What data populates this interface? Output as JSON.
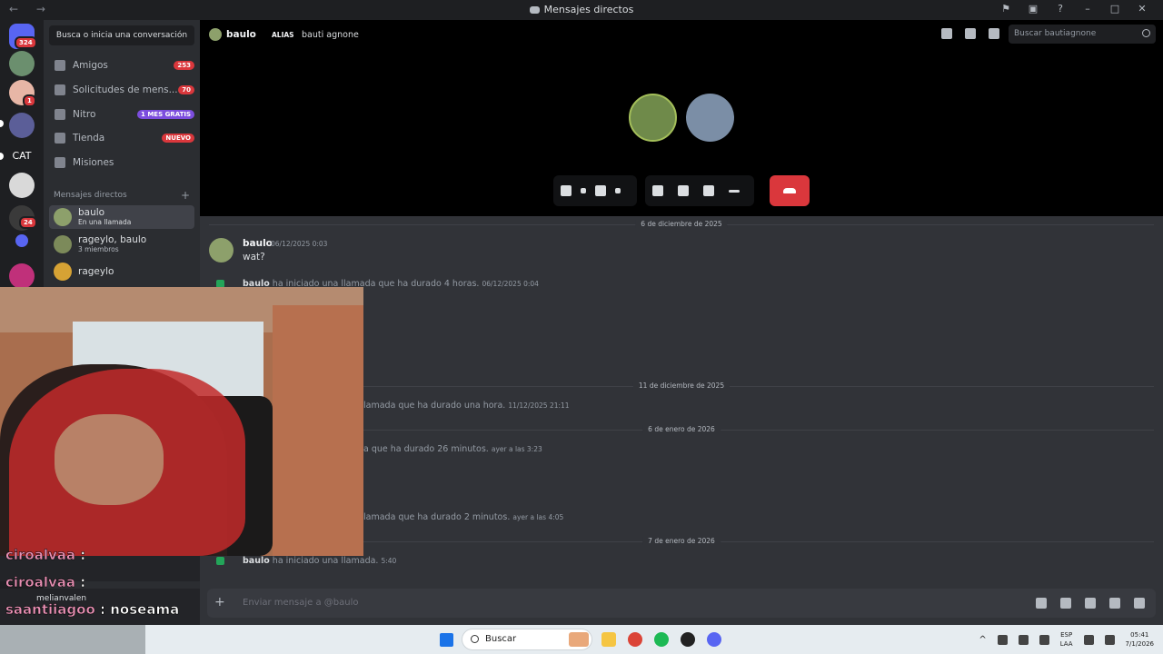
{
  "window": {
    "title": "Mensajes directos",
    "nav": "← →"
  },
  "servers": {
    "home_badge": "324",
    "badge2": "1",
    "label_cat": "CAT",
    "badge_24": "24"
  },
  "sidebar": {
    "search": "Busca o inicia una conversación",
    "items": [
      {
        "label": "Amigos",
        "badge": "253"
      },
      {
        "label": "Solicitudes de mens...",
        "badge": "70"
      },
      {
        "label": "Nitro",
        "badge": "1 MES GRATIS"
      },
      {
        "label": "Tienda",
        "badge": "NUEVO"
      },
      {
        "label": "Misiones",
        "badge": ""
      }
    ],
    "dm_header": "Mensajes directos",
    "dms": [
      {
        "name": "baulo",
        "sub": "En una llamada"
      },
      {
        "name": "rageylo, baulo",
        "sub": "3 miembros"
      },
      {
        "name": "rageylo",
        "sub": ""
      }
    ]
  },
  "header": {
    "name": "baulo",
    "alias_label": "ALIAS",
    "alias_value": "bauti agnone",
    "search_placeholder": "Buscar bautiagnone"
  },
  "chat": {
    "dividers": [
      "6 de diciembre de 2025",
      "11 de diciembre de 2025",
      "6 de enero de 2026",
      "7 de enero de 2026"
    ],
    "message": {
      "author": "baulo",
      "time": "06/12/2025 0:03",
      "text": "wat?"
    },
    "system": [
      {
        "author": "baulo",
        "text": "ha iniciado una llamada que ha durado 4 horas.",
        "time": "06/12/2025 0:04"
      },
      {
        "author": "",
        "text": "lamada que ha durado una hora.",
        "time": "11/12/2025 21:11"
      },
      {
        "author": "",
        "text": "a que ha durado 26 minutos.",
        "time": "ayer a las 3:23"
      },
      {
        "author": "",
        "text": "lamada que ha durado 2 minutos.",
        "time": "ayer a las 4:05"
      },
      {
        "author": "baulo",
        "text": "ha iniciado una llamada.",
        "time": "5:40"
      }
    ]
  },
  "composer": {
    "placeholder": "Enviar mensaje a @baulo"
  },
  "overlay": {
    "lines": [
      {
        "user": "ciroalvaa",
        "sep": " :",
        "msg": ""
      },
      {
        "user": "ciroalvaa",
        "sep": " :",
        "msg": ""
      },
      {
        "user": "saantiiagoo",
        "sep": " : ",
        "msg": "noseama"
      }
    ],
    "user_panel": "melianvalen"
  },
  "taskbar": {
    "search": "Buscar",
    "lang1": "ESP",
    "lang2": "LAA",
    "time": "05:41",
    "date": "7/1/2026"
  },
  "colors": {
    "accent_red": "#da373c",
    "nitro_purple": "#7c4dde",
    "online_green": "#23a559"
  }
}
